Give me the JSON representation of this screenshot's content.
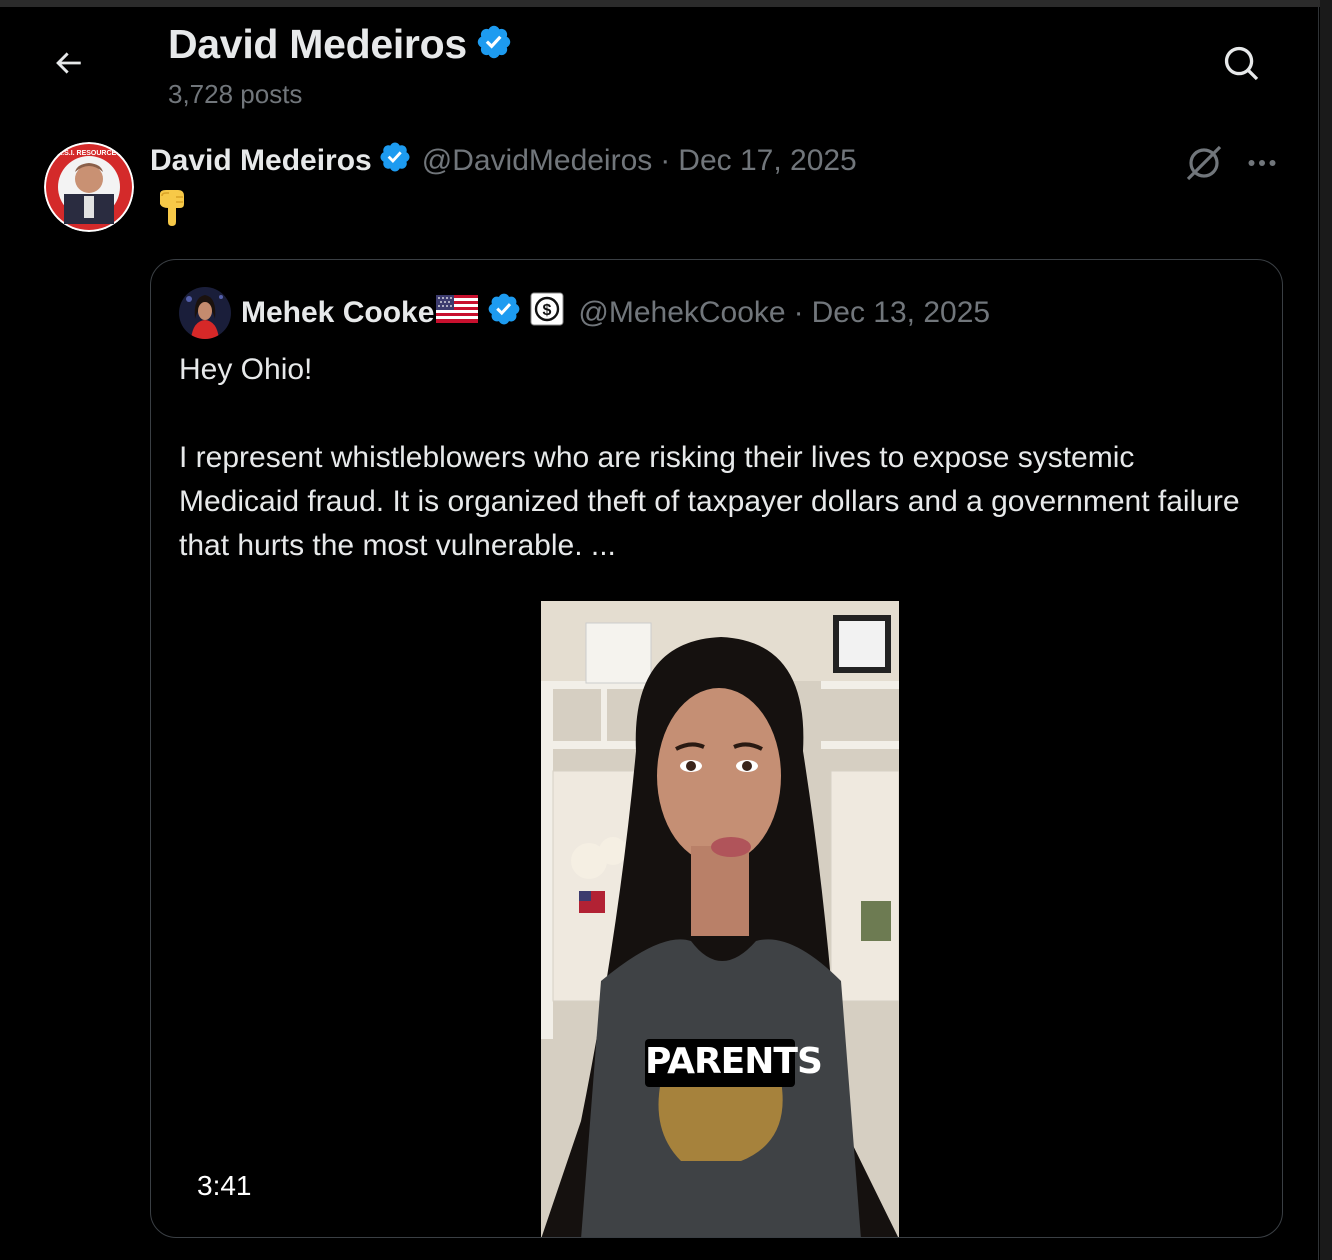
{
  "header": {
    "back_icon": "arrow-left-icon",
    "title": "David Medeiros",
    "posts_count": "3,728 posts",
    "search_icon": "search-icon"
  },
  "post": {
    "author_name": "David Medeiros",
    "handle": "@DavidMedeiros",
    "separator": "·",
    "date": "Dec 17, 2025",
    "emoji": "👇",
    "avatar_text": "ASI RESOURCES",
    "grok_icon": "grok-icon",
    "more_icon": "more-icon"
  },
  "quote": {
    "author_name": "Mehek Cooke",
    "flag_icon": "us-flag-icon",
    "org_icon": "dollar-badge-icon",
    "handle": "@MehekCooke",
    "separator": "·",
    "date": "Dec 13, 2025",
    "text_line1": "Hey Ohio!",
    "text_para2": "I represent whistleblowers who are risking their lives to expose systemic Medicaid fraud. It is organized theft of taxpayer dollars and a government failure that hurts the most vulnerable. ...",
    "video": {
      "caption": "PARENTS",
      "duration": "3:41"
    }
  },
  "colors": {
    "background": "#000000",
    "text": "#e7e9ea",
    "muted": "#71767b",
    "verified": "#1d9bf0",
    "border": "#3a3f44"
  }
}
